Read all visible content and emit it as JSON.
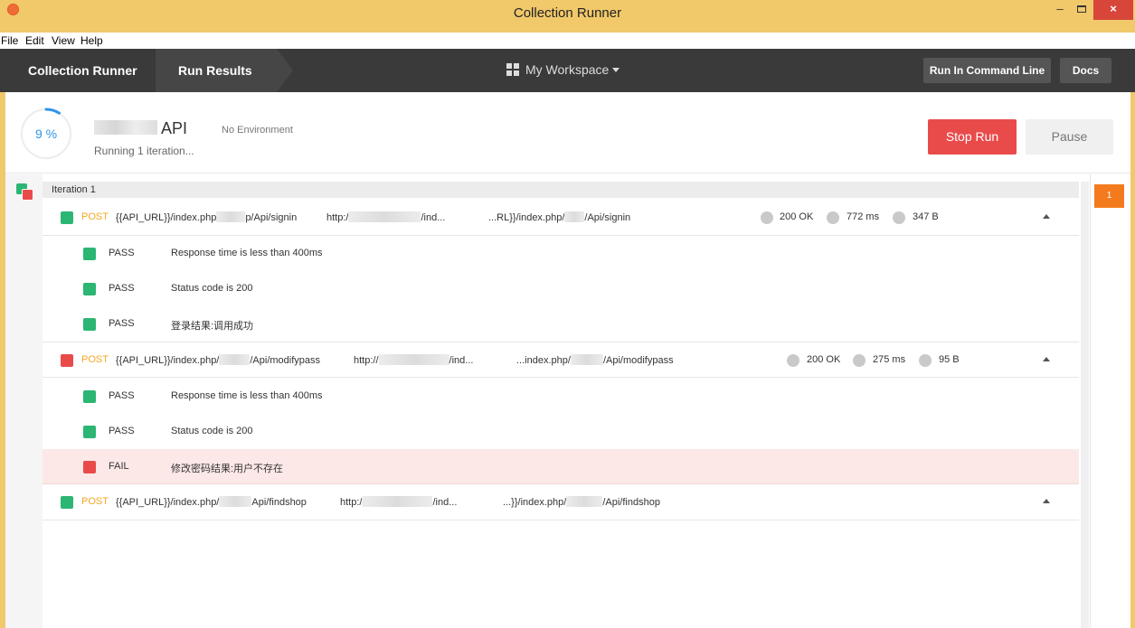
{
  "window": {
    "title": "Collection Runner",
    "minimize": "–",
    "close": "×"
  },
  "menu": [
    "File",
    "Edit",
    "View",
    "Help"
  ],
  "nav": {
    "crumbs": [
      "Collection Runner",
      "Run Results"
    ],
    "workspace": "My Workspace",
    "run_cmd_label": "Run In Command Line",
    "docs_label": "Docs"
  },
  "status": {
    "progress_text": "9 %",
    "progress_fraction": 0.09,
    "collection_suffix": "API",
    "environment": "No Environment",
    "running_text": "Running 1 iteration...",
    "stop_label": "Stop Run",
    "pause_label": "Pause"
  },
  "iteration": {
    "label": "Iteration 1",
    "badge": "1"
  },
  "requests": [
    {
      "status": "green",
      "method": "POST",
      "url_a": "{{API_URL}}/index.php",
      "url_b": "p/Api/signin",
      "http_a": "http:/",
      "http_b": "/ind...",
      "resolved_a": "...RL}}/index.php/",
      "resolved_b": "/Api/signin",
      "code": "200 OK",
      "time": "772 ms",
      "size": "347 B",
      "tests": [
        {
          "result": "PASS",
          "name": "Response time is less than 400ms"
        },
        {
          "result": "PASS",
          "name": "Status code is 200"
        },
        {
          "result": "PASS",
          "name": "登录结果:调用成功"
        }
      ]
    },
    {
      "status": "red",
      "method": "POST",
      "url_a": "{{API_URL}}/index.php/",
      "url_b": "/Api/modifypass",
      "http_a": "http://",
      "http_b": "/ind...",
      "resolved_a": "...index.php/",
      "resolved_b": "/Api/modifypass",
      "code": "200 OK",
      "time": "275 ms",
      "size": "95 B",
      "tests": [
        {
          "result": "PASS",
          "name": "Response time is less than 400ms"
        },
        {
          "result": "PASS",
          "name": "Status code is 200"
        },
        {
          "result": "FAIL",
          "name": "修改密码结果:用户不存在"
        }
      ]
    },
    {
      "status": "green",
      "method": "POST",
      "url_a": "{{API_URL}}/index.php/",
      "url_b": "Api/findshop",
      "http_a": "http:/",
      "http_b": "/ind...",
      "resolved_a": "...}}/index.php/",
      "resolved_b": "/Api/findshop"
    }
  ],
  "colors": {
    "pass": "#2bb673",
    "fail": "#e94b4b",
    "method": "#f5a623",
    "accent": "#f37b1d",
    "stop": "#e94b4b"
  }
}
